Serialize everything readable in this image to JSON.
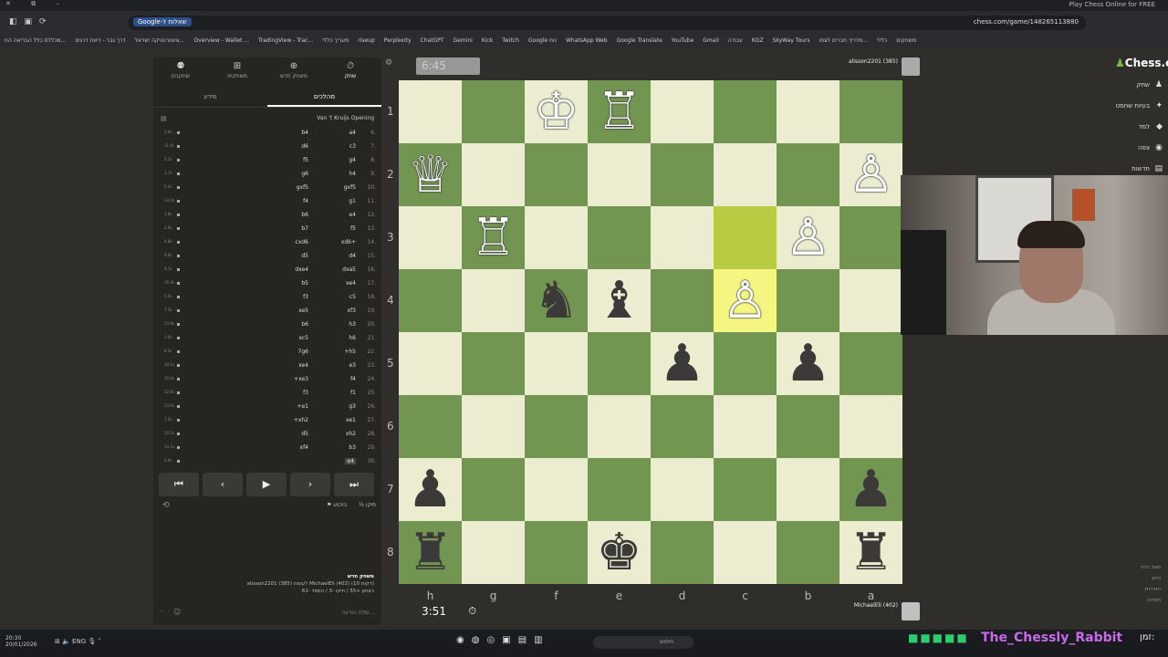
{
  "browser": {
    "tab_title": "Play Chess Online for FREE",
    "url": "chess.com/game/148265113880",
    "google_chip": "Google-שאלות ל",
    "bookmarks": [
      "מכללת כלל הבריאה הח...",
      "דרך גבר - דיווח דרגים",
      "אינטרנטיקה ישראל...",
      "Overview - Wallet ...",
      "TradingView - Trac...",
      "מעריך כללי",
      "riseup",
      "Perplexity",
      "ChatGPT",
      "Gemini",
      "Kick",
      "Twitch",
      "Google נוח",
      "WhatsApp Web",
      "Google Translate",
      "YouTube",
      "Gmail",
      "עבודה",
      "KGZ",
      "SkyWay Tours",
      "מדריך חברים לצפו...",
      "כללי",
      "משחקים"
    ]
  },
  "panel": {
    "tabs": [
      {
        "label": "שחקנים",
        "icon": "players-icon",
        "glyph": "⚉"
      },
      {
        "label": "משחקים",
        "icon": "games-icon",
        "glyph": "⊞"
      },
      {
        "label": "משחק חדש",
        "icon": "new-game-icon",
        "glyph": "⊕"
      },
      {
        "label": "שחק",
        "icon": "timer-icon",
        "glyph": "⏱"
      }
    ],
    "subtabs": [
      "מידע",
      "מהלכים"
    ],
    "opening": "Van 't Kruijs Opening",
    "moves": [
      {
        "n": "6.",
        "w": "a4",
        "b": "b4",
        "t": "2.0s"
      },
      {
        "n": "7.",
        "w": "c3",
        "b": "d6",
        "t": "11.6s"
      },
      {
        "n": "8.",
        "w": "g4",
        "b": "f5",
        "t": "2.2s"
      },
      {
        "n": "9.",
        "w": "h4",
        "b": "g6",
        "t": "1.7s"
      },
      {
        "n": "10.",
        "w": "gxf5",
        "b": "gxf5",
        "t": "5.4s"
      },
      {
        "n": "11.",
        "w": "g1",
        "b": "f4",
        "t": "13.2s"
      },
      {
        "n": "12.",
        "w": "e4",
        "b": "b6",
        "t": "1.8s"
      },
      {
        "n": "13.",
        "w": "f5",
        "b": "b7",
        "t": "2.9s"
      },
      {
        "n": "14.",
        "w": "xd6+",
        "b": "cxd6",
        "t": "4.8s"
      },
      {
        "n": "15.",
        "w": "d4",
        "b": "d5",
        "t": "4.6s"
      },
      {
        "n": "16.",
        "w": "dxa5",
        "b": "dxe4",
        "t": "4.7s"
      },
      {
        "n": "17.",
        "w": "xe4",
        "b": "b5",
        "t": "16.4s"
      },
      {
        "n": "18.",
        "w": "c5",
        "b": "f3",
        "t": "5.0s"
      },
      {
        "n": "19.",
        "w": "xf3",
        "b": "xe5",
        "t": "7.3s"
      },
      {
        "n": "20.",
        "w": "h3",
        "b": "b6",
        "t": "13.9s"
      },
      {
        "n": "21.",
        "w": "h6",
        "b": "xc5",
        "t": "3.0s"
      },
      {
        "n": "22.",
        "w": "+h5",
        "b": "7g6",
        "t": "8.5s"
      },
      {
        "n": "23.",
        "w": "e3",
        "b": "xe4",
        "t": "34.2s"
      },
      {
        "n": "24.",
        "w": "f4",
        "b": "+xe3",
        "t": "10.0s"
      },
      {
        "n": "25.",
        "w": "f1",
        "b": "f3",
        "t": "12.9s"
      },
      {
        "n": "26.",
        "w": "g3",
        "b": "+e1",
        "t": "13.6s"
      },
      {
        "n": "27.",
        "w": "xe1",
        "b": "+xh2",
        "t": "7.2s"
      },
      {
        "n": "28.",
        "w": "xh2",
        "b": "d5",
        "t": "10.5s"
      },
      {
        "n": "29.",
        "w": "b3",
        "b": "xf4",
        "t": "14.1s"
      },
      {
        "n": "30.",
        "w": "e4",
        "b": "",
        "t": "6.9s"
      }
    ],
    "controls": [
      {
        "name": "first-move-button",
        "glyph": "⏮"
      },
      {
        "name": "prev-move-button",
        "glyph": "‹"
      },
      {
        "name": "play-button",
        "glyph": "▶"
      },
      {
        "name": "next-move-button",
        "glyph": "›"
      },
      {
        "name": "last-move-button",
        "glyph": "⏭"
      }
    ],
    "draw_label": "½ תיקו",
    "resign_label": "⚑ היכנע",
    "game_title": "משחק חדש",
    "game_players": "alisson2201 (385) לעומת MichaelEli (402) (10 דקות)",
    "game_result": "ניצחון +55 / תיקו -3 / הפסד -61",
    "chat_placeholder": "שלח הודעה..."
  },
  "clocks": {
    "top": "6:45",
    "bottom": "3:51"
  },
  "players": {
    "top": "alisson2201 (385)",
    "bottom": "MichaelEli (402)"
  },
  "board": {
    "ranks": [
      "1",
      "2",
      "3",
      "4",
      "5",
      "6",
      "7",
      "8"
    ],
    "files": [
      "h",
      "g",
      "f",
      "e",
      "d",
      "c",
      "b",
      "a"
    ],
    "pieces": [
      {
        "sq": "f1",
        "p": "♔",
        "c": "white"
      },
      {
        "sq": "e1",
        "p": "♖",
        "c": "white"
      },
      {
        "sq": "h2",
        "p": "♕",
        "c": "white"
      },
      {
        "sq": "a2",
        "p": "♙",
        "c": "white"
      },
      {
        "sq": "g3",
        "p": "♖",
        "c": "white"
      },
      {
        "sq": "b3",
        "p": "♙",
        "c": "white"
      },
      {
        "sq": "c4",
        "p": "♙",
        "c": "white"
      },
      {
        "sq": "f4",
        "p": "♞",
        "c": "black"
      },
      {
        "sq": "e4",
        "p": "♝",
        "c": "black"
      },
      {
        "sq": "d5",
        "p": "♟",
        "c": "black"
      },
      {
        "sq": "b5",
        "p": "♟",
        "c": "black"
      },
      {
        "sq": "h7",
        "p": "♟",
        "c": "black"
      },
      {
        "sq": "a7",
        "p": "♟",
        "c": "black"
      },
      {
        "sq": "h8",
        "p": "♜",
        "c": "black"
      },
      {
        "sq": "e8",
        "p": "♚",
        "c": "black"
      },
      {
        "sq": "a8",
        "p": "♜",
        "c": "black"
      }
    ],
    "highlights": [
      "c3",
      "c4"
    ]
  },
  "sidebar": {
    "logo": "Chess.com",
    "nav": [
      {
        "label": "שחק",
        "icon": "play-icon",
        "glyph": "♟"
      },
      {
        "label": "בעיות שחמט",
        "icon": "puzzle-icon",
        "glyph": "✦"
      },
      {
        "label": "למד",
        "icon": "learn-icon",
        "glyph": "◆"
      },
      {
        "label": "צפה",
        "icon": "watch-icon",
        "glyph": "◉"
      },
      {
        "label": "חדשות",
        "icon": "news-icon",
        "glyph": "▤"
      }
    ],
    "settings": [
      "מצב כהה",
      "כיווץ",
      "הגדרות",
      "תמיכה"
    ]
  },
  "taskbar": {
    "time": "20:30",
    "date": "20/01/2026",
    "lang": "ENG",
    "search": "חיפוש",
    "overlay_name": "The_Chessly_Rabbit",
    "overlay_tag": "זמן:"
  }
}
